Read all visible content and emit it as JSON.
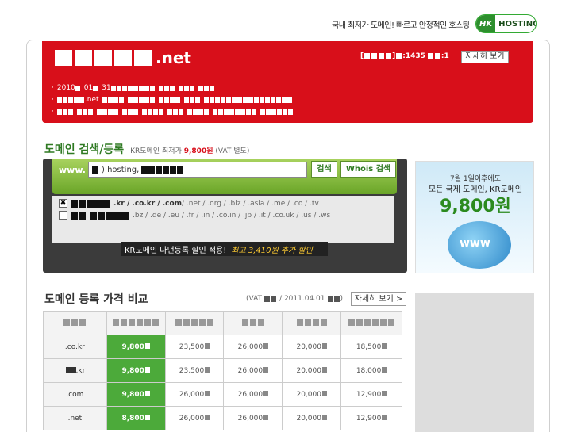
{
  "top_ad": {
    "text": "국내 최저가 도메인! 빠르고 안정적인 호스팅!",
    "logo_hk": "HK",
    "logo_text": "HOSTING.KR"
  },
  "header": {
    "title_suffix": ".net",
    "stats_count": ":1435",
    "stats_extra": ":1",
    "detail_button": "자세히 보기",
    "notice_1": "2010",
    "notice_1b": "01",
    "notice_1c": "31",
    "notice_2": ".net",
    "bg_color": "#d80f1a"
  },
  "search": {
    "title": "도메인 검색/등록",
    "subtitle_prefix": "KR도메인 최저가",
    "subtitle_price": "9,800원",
    "subtitle_suffix": "(VAT 별도)",
    "www_label": "www.",
    "input_value_a": ") hosting,",
    "search_button": "검색",
    "whois_button": "Whois 검색",
    "ext_row1_strong": ".kr / .co.kr / .com",
    "ext_row1_rest": " / .net / .org / .biz / .asia / .me / .co / .tv",
    "ext_row2": ".bz / .de / .eu / .fr / .in / .co.in / .jp / .it / .co.uk / .us / .ws",
    "ext_row1_checked": "✖",
    "promo_text": "KR도메인 다년등록 할인 적용!",
    "promo_highlight": "최고 3,410원 추가 할인"
  },
  "right_ad": {
    "line1": "7월 1일이후에도",
    "line2": "모든 국제 도메인, KR도메인",
    "line3": "9,800원",
    "www": "www"
  },
  "price": {
    "title": "도메인 등록 가격 비교",
    "meta_prefix": "(VAT",
    "meta_date": "/ 2011.04.01",
    "meta_suffix": ")",
    "detail_button": "자세히 보기 >",
    "rows": [
      {
        "ext": ".co.kr",
        "ours": "9,800",
        "c1": "23,500",
        "c2": "26,000",
        "c3": "20,000",
        "c4": "18,500"
      },
      {
        "ext": ".kr",
        "ours": "9,800",
        "c1": "23,500",
        "c2": "26,000",
        "c3": "20,000",
        "c4": "18,000"
      },
      {
        "ext": ".com",
        "ours": "9,800",
        "c1": "26,000",
        "c2": "26,000",
        "c3": "20,000",
        "c4": "12,900"
      },
      {
        "ext": ".net",
        "ours": "8,800",
        "c1": "26,000",
        "c2": "26,000",
        "c3": "20,000",
        "c4": "12,900"
      }
    ],
    "accent_color": "#4caa3a"
  }
}
